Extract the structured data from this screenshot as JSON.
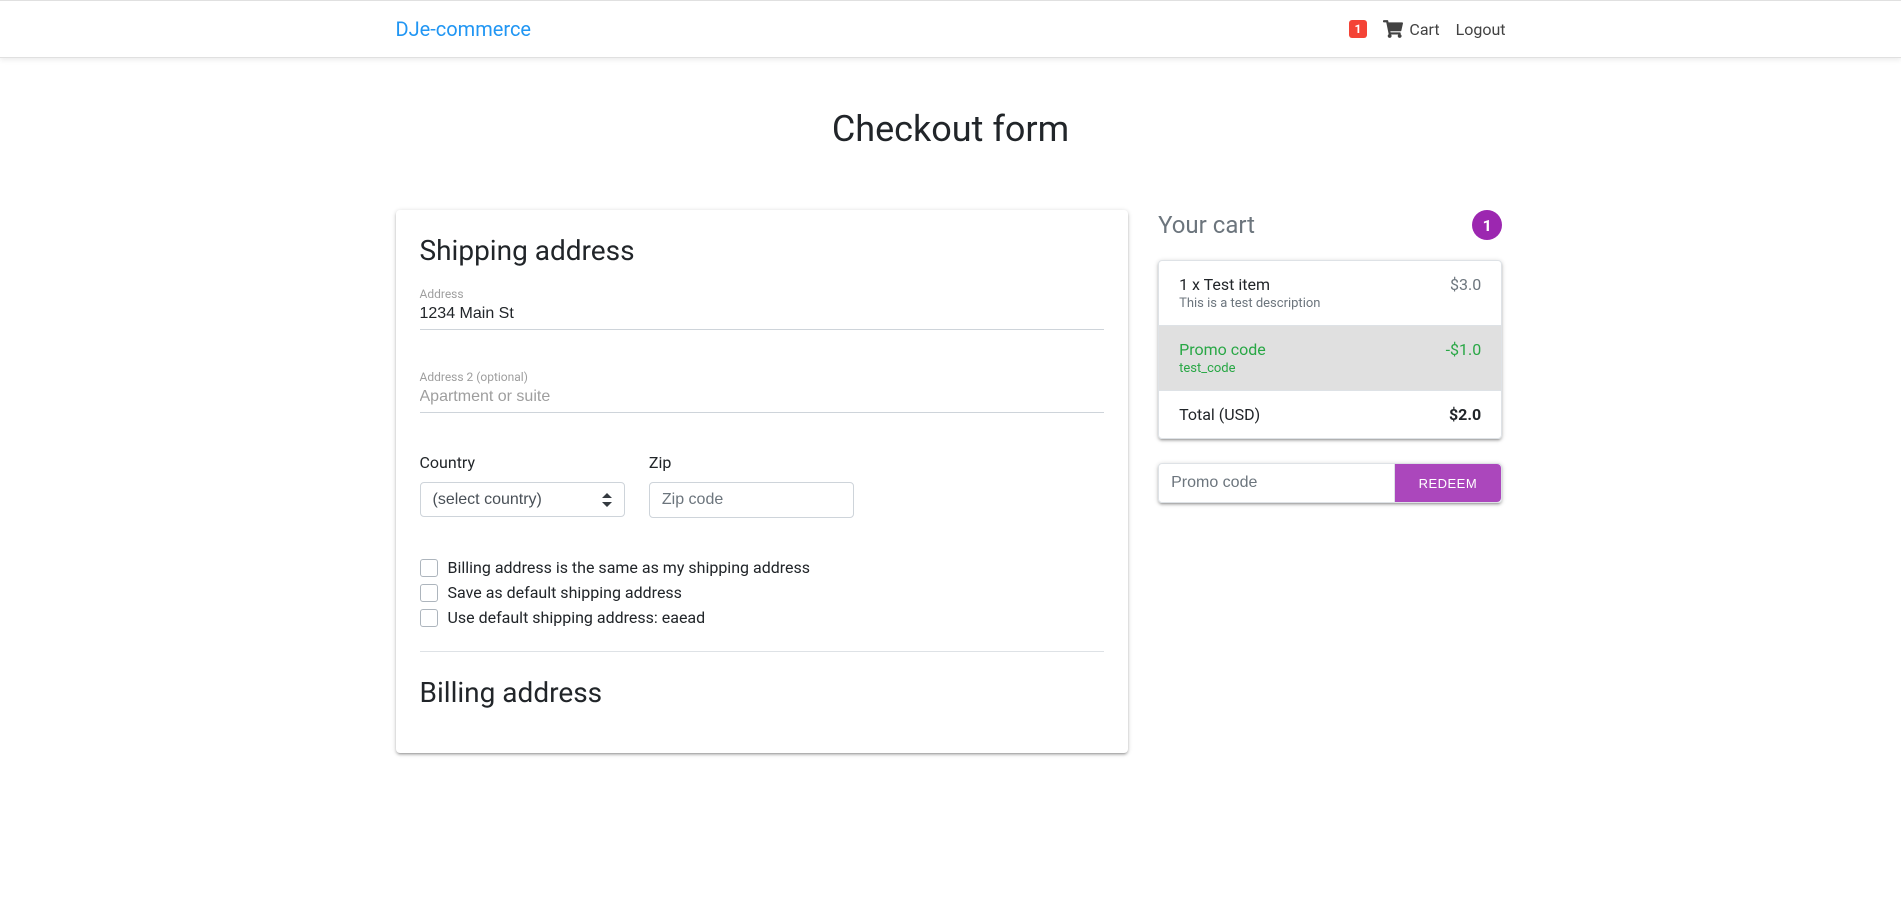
{
  "nav": {
    "brand": "DJe-commerce",
    "cart_badge": "1",
    "cart_label": "Cart",
    "logout_label": "Logout"
  },
  "page": {
    "title": "Checkout form"
  },
  "shipping": {
    "title": "Shipping address",
    "address_label": "Address",
    "address_value": "1234 Main St",
    "address2_label": "Address 2 (optional)",
    "address2_placeholder": "Apartment or suite",
    "country_label": "Country",
    "country_placeholder": "(select country)",
    "zip_label": "Zip",
    "zip_placeholder": "Zip code",
    "cb_same_billing": "Billing address is the same as my shipping address",
    "cb_save_default": "Save as default shipping address",
    "cb_use_default": "Use default shipping address: eaead"
  },
  "billing": {
    "title": "Billing address"
  },
  "cart": {
    "title": "Your cart",
    "count": "1",
    "item_name": "1 x Test item",
    "item_desc": "This is a test description",
    "item_price": "$3.0",
    "promo_label": "Promo code",
    "promo_code": "test_code",
    "promo_discount": "-$1.0",
    "total_label": "Total (USD)",
    "total_price": "$2.0",
    "promo_input_placeholder": "Promo code",
    "redeem_label": "REDEEM"
  }
}
